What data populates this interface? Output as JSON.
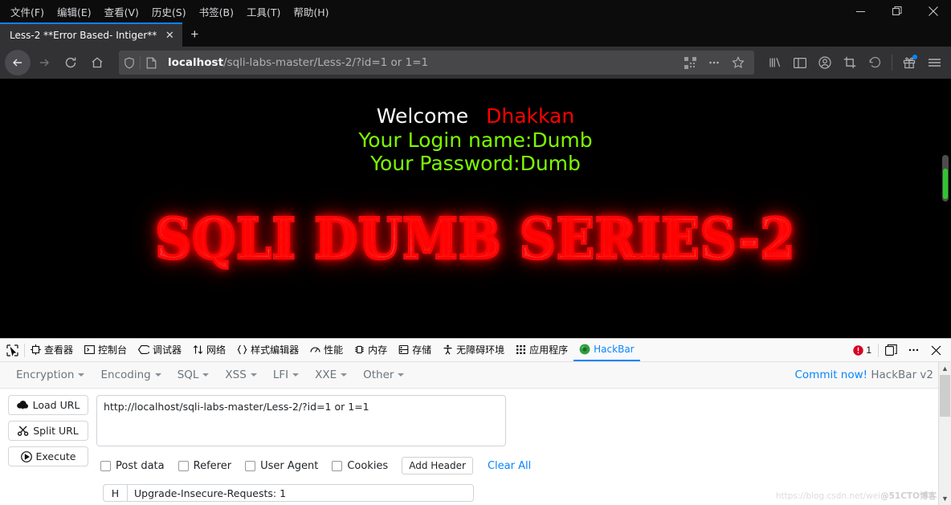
{
  "browser": {
    "menus": [
      {
        "label": "文件(F)"
      },
      {
        "label": "编辑(E)"
      },
      {
        "label": "查看(V)"
      },
      {
        "label": "历史(S)"
      },
      {
        "label": "书签(B)"
      },
      {
        "label": "工具(T)"
      },
      {
        "label": "帮助(H)"
      }
    ],
    "window_controls": {
      "minimize": "—",
      "restore": "❐",
      "close": "✕"
    },
    "tab": {
      "title": "Less-2 **Error Based- Intiger**",
      "close": "✕"
    },
    "new_tab": "+",
    "nav": {
      "back": "←",
      "forward": "→",
      "reload": "↻",
      "home": "⌂"
    },
    "url": {
      "host": "localhost",
      "path": "/sqli-labs-master/Less-2/?id=1 or 1=1",
      "full": "localhost/sqli-labs-master/Less-2/?id=1 or 1=1"
    }
  },
  "page": {
    "welcome": "Welcome",
    "user": "Dhakkan",
    "login_line": "Your Login name:Dumb",
    "password_line": "Your Password:Dumb",
    "banner": "SQLI DUMB SERIES-2"
  },
  "devtools": {
    "tabs": [
      {
        "label": "查看器",
        "icon": "inspector-icon",
        "active": false
      },
      {
        "label": "控制台",
        "icon": "console-icon",
        "active": false
      },
      {
        "label": "调试器",
        "icon": "debugger-icon",
        "active": false
      },
      {
        "label": "网络",
        "icon": "network-icon",
        "active": false
      },
      {
        "label": "样式编辑器",
        "icon": "style-editor-icon",
        "active": false
      },
      {
        "label": "性能",
        "icon": "performance-icon",
        "active": false
      },
      {
        "label": "内存",
        "icon": "memory-icon",
        "active": false
      },
      {
        "label": "存储",
        "icon": "storage-icon",
        "active": false
      },
      {
        "label": "无障碍环境",
        "icon": "accessibility-icon",
        "active": false
      },
      {
        "label": "应用程序",
        "icon": "application-icon",
        "active": false
      },
      {
        "label": "HackBar",
        "icon": "hackbar-icon",
        "active": true
      }
    ],
    "error_count": "1",
    "accent": "#0a84ff"
  },
  "hackbar": {
    "menus": [
      {
        "label": "Encryption"
      },
      {
        "label": "Encoding"
      },
      {
        "label": "SQL"
      },
      {
        "label": "XSS"
      },
      {
        "label": "LFI"
      },
      {
        "label": "XXE"
      },
      {
        "label": "Other"
      }
    ],
    "commit_link": "Commit now!",
    "version": "HackBar v2",
    "buttons": [
      {
        "label": "Load URL",
        "icon": "cloud-download-icon"
      },
      {
        "label": "Split URL",
        "icon": "scissors-icon"
      },
      {
        "label": "Execute",
        "icon": "play-icon"
      }
    ],
    "url_value": "http://localhost/sqli-labs-master/Less-2/?id=1 or 1=1",
    "checkboxes": [
      {
        "label": "Post data",
        "checked": false
      },
      {
        "label": "Referer",
        "checked": false
      },
      {
        "label": "User Agent",
        "checked": false
      },
      {
        "label": "Cookies",
        "checked": false
      }
    ],
    "add_header": "Add Header",
    "clear_all": "Clear All",
    "header_row": {
      "key": "H",
      "value": "Upgrade-Insecure-Requests: 1"
    }
  },
  "watermark": {
    "text": "https://blog.csdn.net/wei",
    "suffix": "@51CTO博客"
  }
}
